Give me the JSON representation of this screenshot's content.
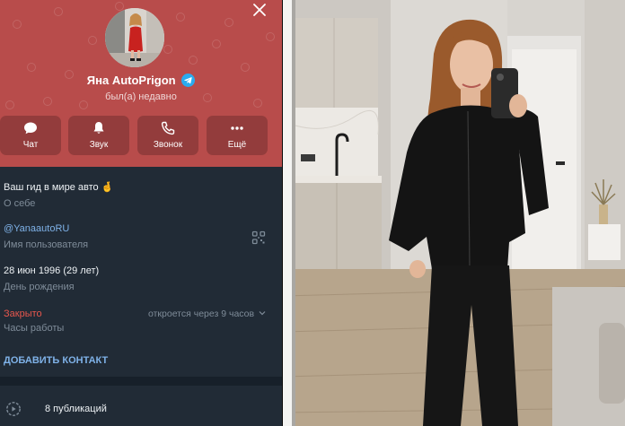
{
  "profile": {
    "name": "Яна AutoPrigon",
    "status": "был(а) недавно",
    "verified_color": "#2aabee",
    "header_color": "#b84c4b"
  },
  "actions": [
    {
      "label": "Чат",
      "icon": "chat-icon"
    },
    {
      "label": "Звук",
      "icon": "bell-icon"
    },
    {
      "label": "Звонок",
      "icon": "phone-icon"
    },
    {
      "label": "Ещё",
      "icon": "more-icon"
    }
  ],
  "info": {
    "bio": "Ваш гид в мире авто 🤞",
    "bio_label": "О себе",
    "username": "@YanaautoRU",
    "username_label": "Имя пользователя",
    "birthday": "28 июн 1996 (29 лет)",
    "birthday_label": "День рождения",
    "hours_status": "Закрыто",
    "hours_hint": "откроется через 9 часов",
    "hours_label": "Часы работы",
    "add_contact": "ДОБАВИТЬ КОНТАКТ"
  },
  "publications": {
    "label": "8 публикаций"
  }
}
